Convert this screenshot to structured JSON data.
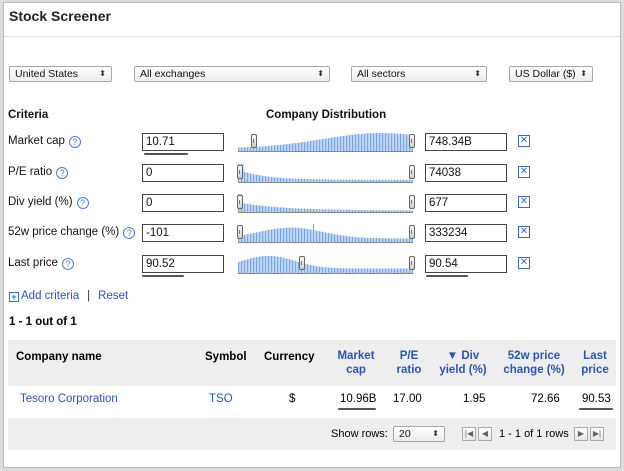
{
  "title": "Stock Screener",
  "filters": {
    "region": "United States",
    "exchange": "All exchanges",
    "sector": "All sectors",
    "currency": "US Dollar ($)"
  },
  "headers": {
    "criteria": "Criteria",
    "distribution": "Company Distribution"
  },
  "criteria": [
    {
      "label": "Market cap",
      "min": "10.71",
      "max": "748.34B"
    },
    {
      "label": "P/E ratio",
      "min": "0",
      "max": "74038"
    },
    {
      "label": "Div yield (%)",
      "min": "0",
      "max": "677"
    },
    {
      "label": "52w price change (%)",
      "min": "-101",
      "max": "333234"
    },
    {
      "label": "Last price",
      "min": "90.52",
      "max": "90.54"
    }
  ],
  "remove_icon": "x-icon",
  "help_icon": "question-icon",
  "actions": {
    "add": "Add criteria",
    "separator": "|",
    "reset": "Reset"
  },
  "results_count": "1 - 1 out of 1",
  "table": {
    "columns": {
      "company": "Company name",
      "symbol": "Symbol",
      "currency": "Currency",
      "market_cap_1": "Market",
      "market_cap_2": "cap",
      "pe_1": "P/E",
      "pe_2": "ratio",
      "div_1": "▼ Div",
      "div_2": "yield (%)",
      "chg_1": "52w price",
      "chg_2": "change (%)",
      "price_1": "Last",
      "price_2": "price"
    },
    "rows": [
      {
        "company": "Tesoro Corporation",
        "symbol": "TSO",
        "currency": "$",
        "market_cap": "10.96B",
        "pe": "17.00",
        "div": "1.95",
        "chg": "72.66",
        "price": "90.53"
      }
    ]
  },
  "pager": {
    "show_rows_label": "Show rows:",
    "rows_value": "20",
    "page_text": "1 - 1 of 1 rows"
  },
  "colors": {
    "accent": "#2a55b5",
    "histogram": "#6a9fe0"
  }
}
